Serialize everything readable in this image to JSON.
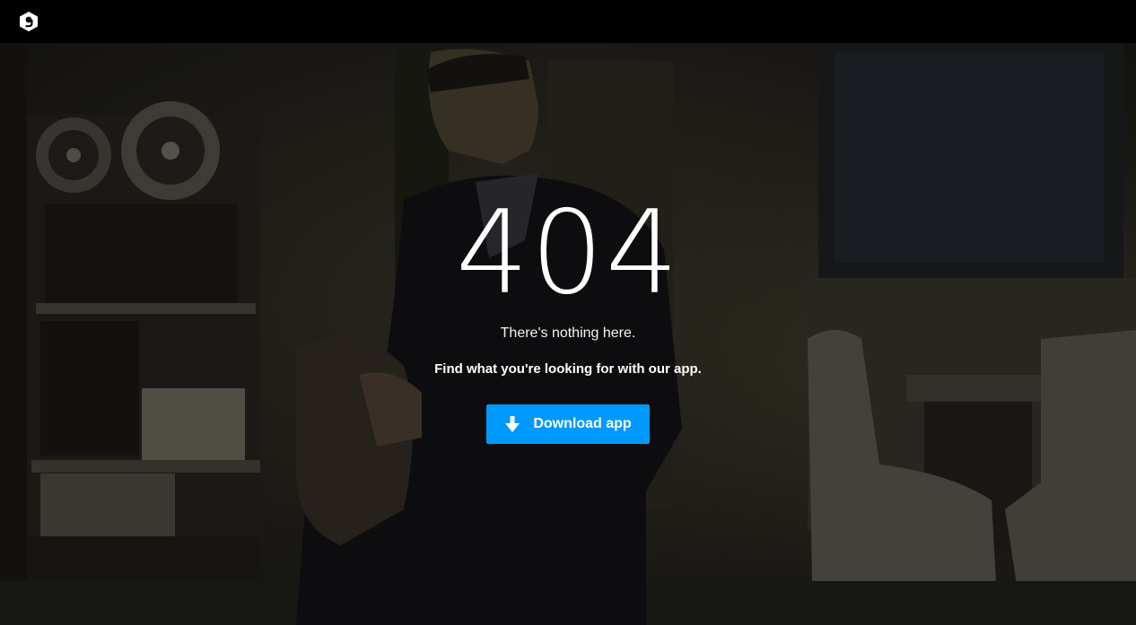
{
  "header": {
    "logo_icon": "9gag-logo-icon"
  },
  "error": {
    "code": "404",
    "message": "There's nothing here.",
    "cta_text": "Find what you're looking for with our app."
  },
  "download_button": {
    "label": "Download app",
    "icon": "download-arrow-icon",
    "color": "#0099ff"
  }
}
